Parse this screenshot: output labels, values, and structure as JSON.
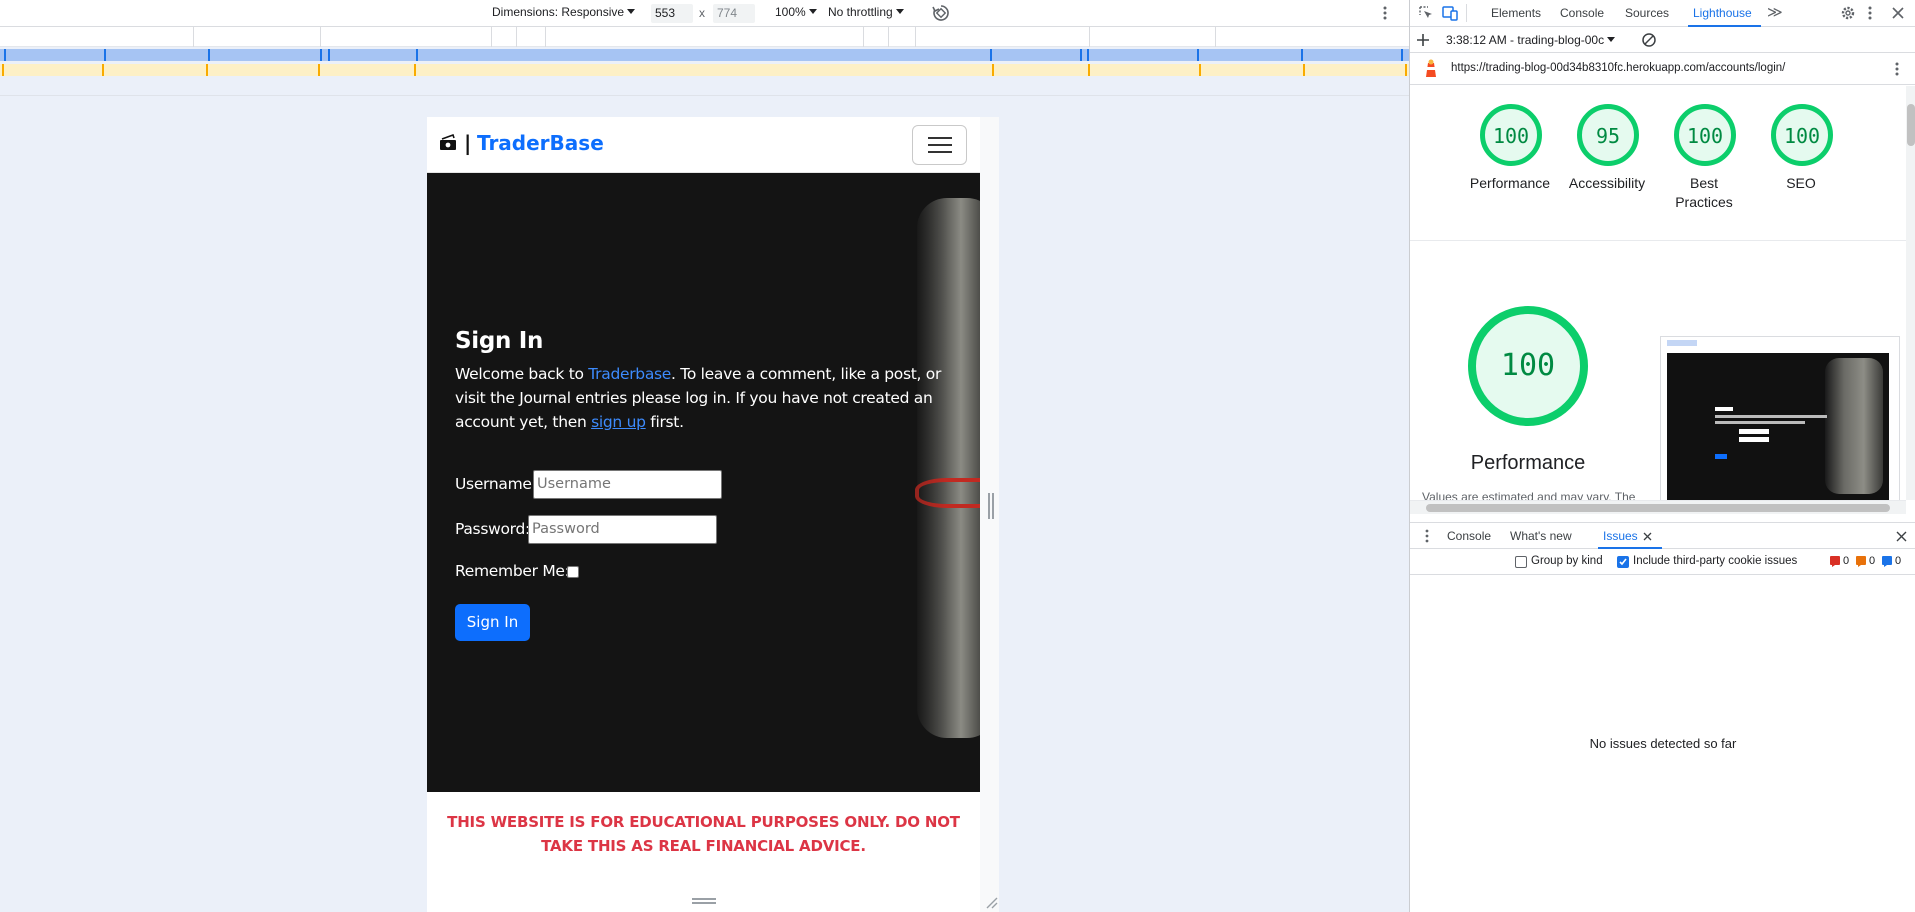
{
  "device_toolbar": {
    "dimensions_label": "Dimensions: Responsive",
    "width": "553",
    "times": "x",
    "height": "774",
    "zoom": "100%",
    "throttling": "No throttling"
  },
  "site": {
    "brand_sep": "|",
    "brand_name": "TraderBase",
    "signin_title": "Sign In",
    "intro_before": "Welcome back to ",
    "intro_brand": "Traderbase",
    "intro_middle": ". To leave a comment, like a post, or visit the Journal entries please log in. If you have not created an account yet, then ",
    "intro_link": "sign up",
    "intro_after": " first.",
    "username_label": "Username:",
    "username_placeholder": "Username",
    "password_label": "Password:",
    "password_placeholder": "Password",
    "remember_label": "Remember Me:",
    "signin_button": "Sign In",
    "disclaimer": "THIS WEBSITE IS FOR EDUCATIONAL PURPOSES ONLY. DO NOT TAKE THIS AS REAL FINANCIAL ADVICE."
  },
  "devtools": {
    "tabs": [
      "Elements",
      "Console",
      "Sources",
      "Lighthouse"
    ],
    "more_tabs": "≫",
    "lighthouse": {
      "report_select": "3:38:12 AM - trading-blog-00c",
      "url": "https://trading-blog-00d34b8310fc.herokuapp.com/accounts/login/",
      "scores": [
        {
          "value": "100",
          "label": "Performance"
        },
        {
          "value": "95",
          "label": "Accessibility"
        },
        {
          "value": "100",
          "label": "Best Practices"
        },
        {
          "value": "100",
          "label": "SEO"
        }
      ],
      "main_score": "100",
      "main_label": "Performance",
      "note": "Values are estimated and may vary. The"
    },
    "drawer": {
      "tabs": [
        "Console",
        "What's new",
        "Issues"
      ],
      "group_by_kind": "Group by kind",
      "include_third_party": "Include third-party cookie issues",
      "counts": [
        "0",
        "0",
        "0"
      ],
      "empty_message": "No issues detected so far"
    }
  },
  "colors": {
    "brand_blue": "#0d6efd",
    "disclaimer_red": "#dc3545",
    "lighthouse_green": "#0cce6b",
    "devtools_blue": "#1a73e8"
  }
}
